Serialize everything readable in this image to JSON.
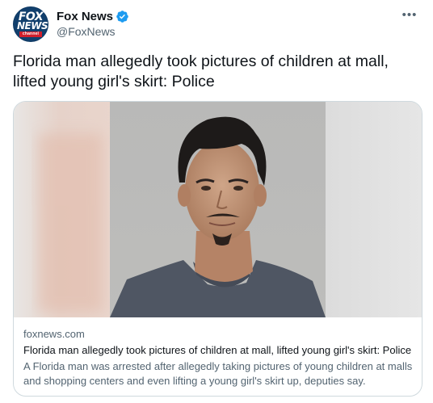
{
  "account": {
    "display_name": "Fox News",
    "handle": "@FoxNews",
    "verified": true,
    "avatar": {
      "logo_line1": "FOX",
      "logo_line2": "NEWS",
      "logo_line3": "channel"
    }
  },
  "tweet": {
    "text": "Florida man allegedly took pictures of children at mall, lifted young girl's skirt: Police"
  },
  "card": {
    "image_description_icon": "mugshot-photo",
    "domain": "foxnews.com",
    "title": "Florida man allegedly took pictures of children at mall, lifted young girl's skirt: Police",
    "description": "A Florida man was arrested after allegedly taking pictures of young children at malls and shopping centers and even lifting a young girl's skirt up, deputies say."
  },
  "icons": {
    "more": "more-icon",
    "verified": "verified-badge-icon"
  },
  "colors": {
    "text_primary": "#0f1419",
    "text_secondary": "#536471",
    "verified_blue": "#1d9bf0",
    "border": "#cfd9de",
    "fox_blue": "#113f6d",
    "fox_red": "#d01f2c"
  }
}
